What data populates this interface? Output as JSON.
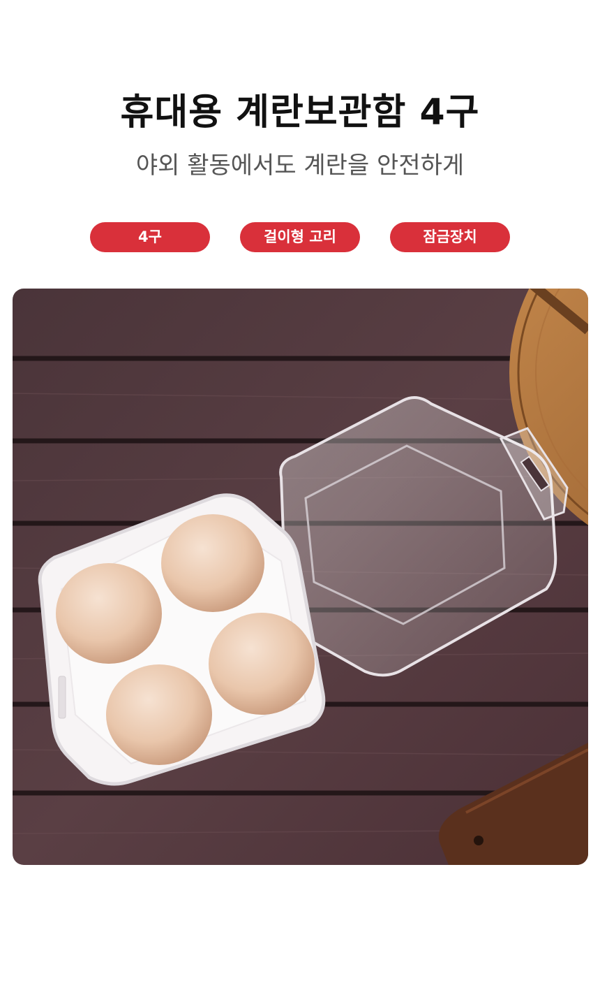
{
  "title": "휴대용 계란보관함 4구",
  "subtitle": "야외 활동에서도 계란을 안전하게",
  "features": [
    {
      "label": "4구"
    },
    {
      "label": "걸이형 고리"
    },
    {
      "label": "잠금장치"
    }
  ],
  "colors": {
    "accent": "#D9303A",
    "title": "#111111",
    "subtitle": "#555555"
  },
  "photo": {
    "subject": "egg-storage-box-4-eggs-photo"
  }
}
